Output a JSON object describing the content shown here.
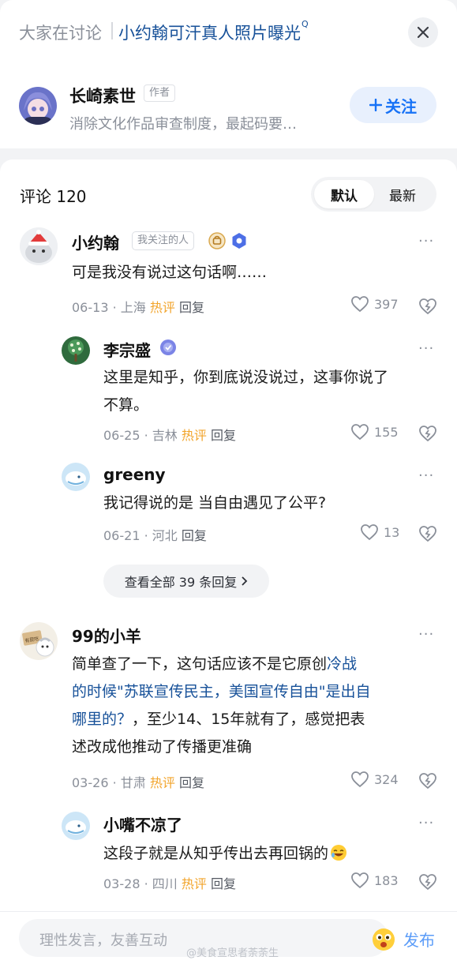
{
  "topbar": {
    "prefix": "大家在讨论",
    "topic": "小约翰可汗真人照片曝光",
    "topic_sup": "Q"
  },
  "author": {
    "name": "长崎素世",
    "tag": "作者",
    "description": "消除文化作品审查制度，最起码要…",
    "follow_label": "关注"
  },
  "comments_header": {
    "count_label": "评论 120",
    "sort_default": "默认",
    "sort_latest": "最新"
  },
  "comments": [
    {
      "user": "小约翰",
      "tag": "我关注的人",
      "lines": [
        "可是我没有说过这句话啊……"
      ],
      "date": "06-13",
      "location": "上海",
      "hot": "热评",
      "reply": "回复",
      "likes": "397",
      "replies": [
        {
          "user": "李宗盛",
          "lines": [
            "这里是知乎，你到底说没说过，这事你说了",
            "不算。"
          ],
          "date": "06-25",
          "location": "吉林",
          "hot": "热评",
          "reply": "回复",
          "likes": "155"
        },
        {
          "user": "greeny",
          "lines": [
            "我记得说的是 当自由遇见了公平?"
          ],
          "date": "06-21",
          "location": "河北",
          "reply": "回复",
          "likes": "13"
        }
      ],
      "view_all": "查看全部 39 条回复"
    },
    {
      "user": "99的小羊",
      "avatar_sign": "有屁吃",
      "text_line1": "简单查了一下，这句话应该不是它原创",
      "link_part1": "冷战",
      "link_line2": "的时候\"苏联宣传民主，美国宣传自由\"是出自",
      "link_line3": "哪里的？",
      "text_line3_rest": "，至少14、15年就有了，感觉把表",
      "text_line4": "述改成他推动了传播更准确",
      "date": "03-26",
      "location": "甘肃",
      "hot": "热评",
      "reply": "回复",
      "likes": "324",
      "replies": [
        {
          "user": "小嘴不凉了",
          "lines": [
            "这段子就是从知乎传出去再回锅的"
          ],
          "date": "03-28",
          "location": "四川",
          "hot": "热评",
          "reply": "回复",
          "likes": "183"
        }
      ]
    }
  ],
  "input": {
    "placeholder": "理性发言，友善互动",
    "publish_label": "发布"
  },
  "watermark": "@美食宣思者荼荼生",
  "colors": {
    "link": "#175199",
    "accent": "#1772f6",
    "hot": "#f2a42b",
    "muted": "#8a8f99"
  }
}
